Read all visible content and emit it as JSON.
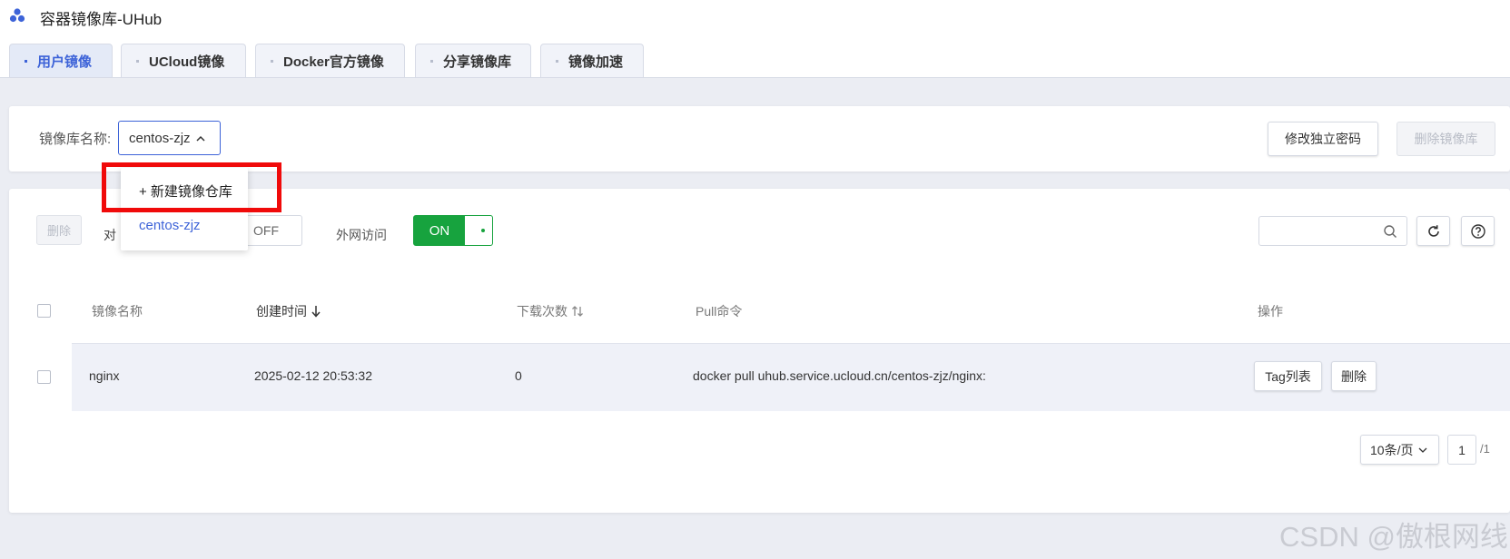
{
  "app": {
    "title": "容器镜像库-UHub",
    "logo_icon": "cluster-icon"
  },
  "tabs": [
    {
      "label": "用户镜像",
      "active": true
    },
    {
      "label": "UCloud镜像",
      "active": false
    },
    {
      "label": "Docker官方镜像",
      "active": false
    },
    {
      "label": "分享镜像库",
      "active": false
    },
    {
      "label": "镜像加速",
      "active": false
    }
  ],
  "repo_bar": {
    "label": "镜像库名称:",
    "selected": "centos-zjz",
    "change_password_label": "修改独立密码",
    "delete_repo_label": "删除镜像库"
  },
  "dropdown": {
    "options": [
      "+ 新建镜像仓库",
      "centos-zjz"
    ]
  },
  "toolbar": {
    "delete_label": "删除",
    "partial_label": "对",
    "off_label": "OFF",
    "external_label": "外网访问",
    "external_state": "ON",
    "search_placeholder": ""
  },
  "table": {
    "headers": [
      "镜像名称",
      "创建时间",
      "下载次数",
      "Pull命令",
      "操作"
    ],
    "rows": [
      {
        "name": "nginx",
        "created": "2025-02-12 20:53:32",
        "downloads": "0",
        "pull": "docker pull uhub.service.ucloud.cn/centos-zjz/nginx:",
        "actions": [
          "Tag列表",
          "删除"
        ]
      }
    ]
  },
  "pagination": {
    "page_size": "10条/页",
    "page": "1",
    "total": "/1"
  },
  "watermark": "CSDN @傲根网线",
  "colors": {
    "accent": "#3d63d8",
    "on_green": "#17a33e",
    "highlight_red": "#f00a0a"
  }
}
